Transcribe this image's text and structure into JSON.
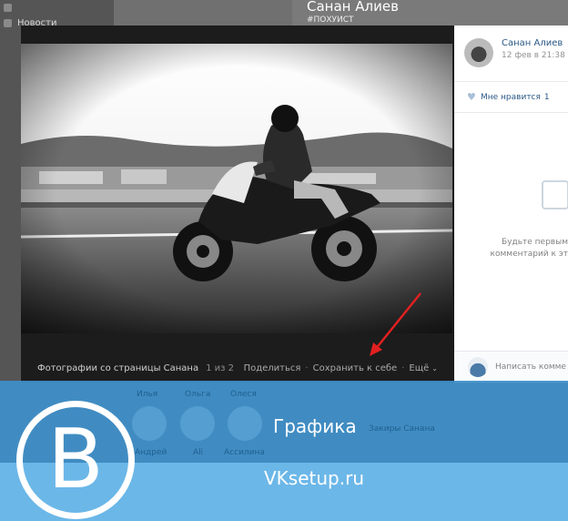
{
  "background": {
    "nav_items": [
      "",
      "Новости",
      "",
      "",
      "",
      "",
      "",
      "",
      "",
      "",
      "",
      "",
      "",
      "",
      "",
      "",
      "",
      "",
      "",
      "",
      "",
      ""
    ],
    "profile_name": "Санан Алиев",
    "profile_status": "#ПОХУИСТ"
  },
  "viewer": {
    "caption": "Фотографии со страницы Санана",
    "counter": "1 из 2",
    "actions": {
      "share": "Поделиться",
      "save": "Сохранить к себе",
      "more": "Ещё"
    }
  },
  "side": {
    "author": "Санан Алиев",
    "date": "12 фев в 21:38",
    "like_label": "Мне нравится",
    "like_count": "1",
    "empty_line1": "Будьте первым",
    "empty_line2": "комментарий к эт",
    "reply_placeholder": "Написать комме"
  },
  "banner": {
    "title": "Графика",
    "site": "VKsetup.ru",
    "friends": [
      "Илья",
      "Ольга",
      "Олеся"
    ],
    "friends_below": [
      "Андрей",
      "Ali",
      "Ассилина",
      "Закиры Санана"
    ]
  },
  "colors": {
    "banner_blue": "#3d8fc9",
    "banner_light": "#6bb7e8",
    "link": "#2a5885",
    "arrow": "#e02020"
  }
}
